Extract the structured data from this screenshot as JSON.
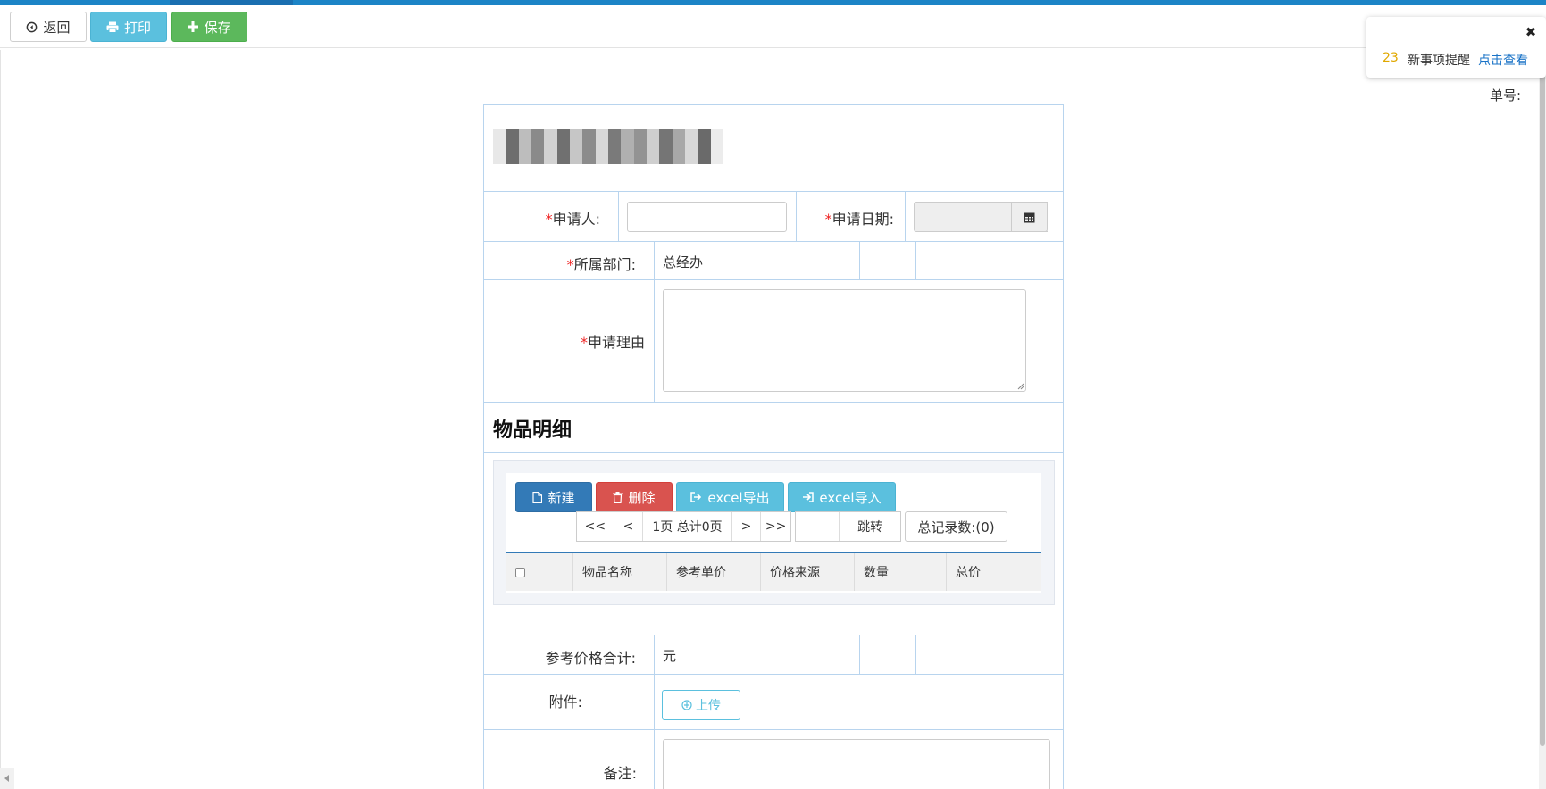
{
  "toolbar": {
    "back_label": "返回",
    "print_label": "打印",
    "save_label": "保存"
  },
  "notify": {
    "count": "23",
    "message": "新事项提醒",
    "link": "点击查看"
  },
  "form": {
    "danhao_label": "单号:",
    "applicant_label": "申请人:",
    "apply_date_label": "申请日期:",
    "dept_label": "所属部门:",
    "dept_value": "总经办",
    "reason_label": "申请理由",
    "required_mark": "*"
  },
  "items": {
    "section_title": "物品明细",
    "new_label": "新建",
    "delete_label": "删除",
    "export_label": "excel导出",
    "import_label": "excel导入",
    "pager": {
      "first": "<<",
      "prev": "<",
      "info": "1页 总计0页",
      "next": ">",
      "last": ">>",
      "jump": "跳转",
      "total": "总记录数:(0)"
    },
    "columns": [
      "物品名称",
      "参考单价",
      "价格来源",
      "数量",
      "总价"
    ]
  },
  "summary": {
    "ref_total_label": "参考价格合计:",
    "ref_total_unit": "元",
    "attachment_label": "附件:",
    "upload_label": "上传",
    "remark_label": "备注:"
  },
  "colors": {
    "primary": "#337ab7",
    "info": "#5bc0de",
    "success": "#5cb85c",
    "danger": "#d9534f",
    "border": "#b8d4ee"
  }
}
